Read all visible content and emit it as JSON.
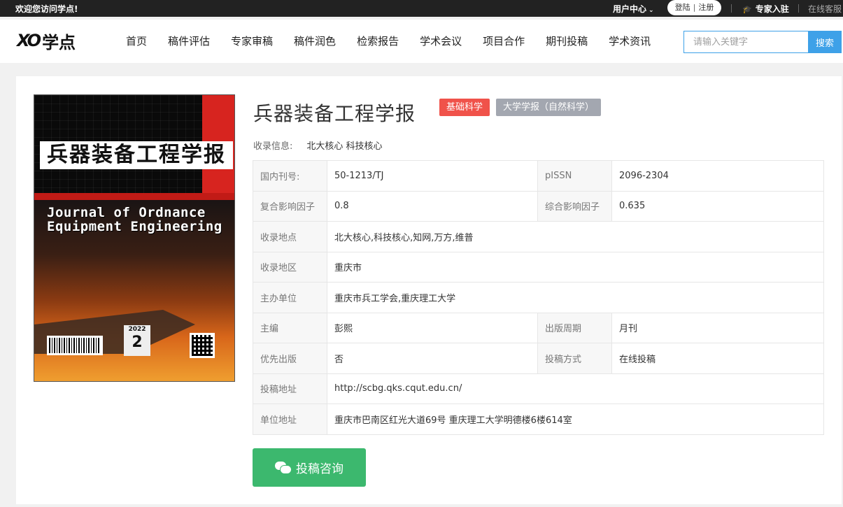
{
  "topbar": {
    "welcome": "欢迎您访问学点!",
    "user_center": "用户中心",
    "login": "登陆",
    "register": "注册",
    "expert_join": "专家入驻",
    "online_service": "在线客服"
  },
  "header": {
    "logo_mark": "XO",
    "logo_text": "学点",
    "nav": [
      "首页",
      "稿件评估",
      "专家审稿",
      "稿件润色",
      "检索报告",
      "学术会议",
      "项目合作",
      "期刊投稿",
      "学术资讯"
    ],
    "search_placeholder": "请输入关键字",
    "search_button": "搜索"
  },
  "journal": {
    "title": "兵器装备工程学报",
    "tags": [
      "基础科学",
      "大学学报（自然科学）"
    ],
    "collection_label": "收录信息:",
    "collection_value": "北大核心  科技核心",
    "cover": {
      "cn_title": "兵器装备工程学报",
      "en_line1": "Journal of Ordnance",
      "en_line2": "Equipment Engineering",
      "year": "2022",
      "issue": "2"
    },
    "fields": {
      "cn_number_label": "国内刊号:",
      "cn_number": "50-1213/TJ",
      "pissn_label": "pISSN",
      "pissn": "2096-2304",
      "composite_if_label": "复合影响因子",
      "composite_if": "0.8",
      "overall_if_label": "综合影响因子",
      "overall_if": "0.635",
      "indexed_label": "收录地点",
      "indexed": "北大核心,科技核心,知网,万方,维普",
      "region_label": "收录地区",
      "region": "重庆市",
      "sponsor_label": "主办单位",
      "sponsor": "重庆市兵工学会,重庆理工大学",
      "editor_label": "主编",
      "editor": "彭熙",
      "frequency_label": "出版周期",
      "frequency": "月刊",
      "priority_label": "优先出版",
      "priority": "否",
      "method_label": "投稿方式",
      "method": "在线投稿",
      "url_label": "投稿地址",
      "url": "http://scbg.qks.cqut.edu.cn/",
      "address_label": "单位地址",
      "address": "重庆市巴南区红光大道69号 重庆理工大学明德楼6楼614室"
    },
    "consult_button": "投稿咨询"
  }
}
